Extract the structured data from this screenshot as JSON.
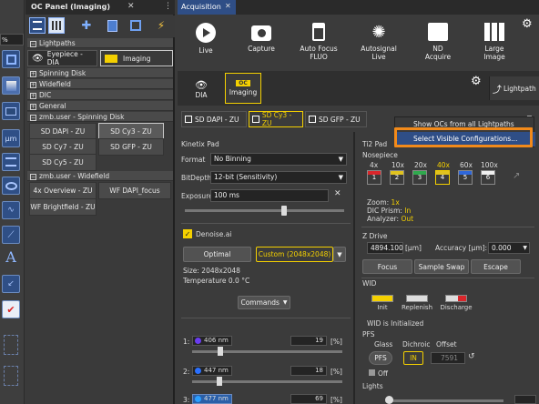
{
  "left_toolbar": {
    "zoom_value": "%"
  },
  "oc_panel": {
    "tab_title": "OC Panel (Imaging)",
    "lightpaths": {
      "header": "Lightpaths",
      "eyepiece": "Eyepiece - DIA",
      "imaging": "Imaging"
    },
    "groups": [
      "Spinning Disk",
      "Widefield",
      "DIC",
      "General"
    ],
    "spinning": {
      "header": "zmb.user - Spinning Disk",
      "items": [
        "SD DAPI - ZU",
        "SD Cy3 - ZU",
        "SD Cy7 - ZU",
        "SD GFP - ZU",
        "SD Cy5 - ZU"
      ]
    },
    "widefield": {
      "header": "zmb.user - Widefield",
      "items": [
        "4x Overview - ZU",
        "WF DAPI_focus",
        "WF Brightfield - ZU"
      ]
    }
  },
  "acquisition": {
    "tab_title": "Acquisition",
    "buttons": [
      {
        "label": "Live",
        "icon": "play-icon"
      },
      {
        "label": "Capture",
        "icon": "camera-icon"
      },
      {
        "label": "Auto Focus\nFLUO",
        "icon": "autofocus-icon"
      },
      {
        "label": "Autosignal\nLive",
        "icon": "brightness-icon"
      },
      {
        "label": "ND\nAcquire",
        "icon": "nd-icon"
      },
      {
        "label": "Large\nImage",
        "icon": "large-image-icon"
      }
    ],
    "mode_tabs": [
      {
        "label": "DIA"
      },
      {
        "label": "Imaging",
        "badge": "OC"
      }
    ],
    "lightpath_label": "Lightpath",
    "config_tabs": [
      "SD DAPI - ZU",
      "SD Cy3 - ZU",
      "SD GFP - ZU"
    ],
    "dropdown_menu": [
      "Show OCs from all Lightpaths",
      "Select Visible Configurations..."
    ]
  },
  "camera": {
    "title": "Kinetix Pad",
    "format_label": "Format",
    "format_value": "No Binning",
    "bitdepth_label": "BitDepth",
    "bitdepth_value": "12-bit (Sensitivity)",
    "exposure_label": "Exposure",
    "exposure_value": "100 ms",
    "exposure_slider": 0.62,
    "denoise_label": "Denoise.ai",
    "denoise_checked": true,
    "optimal_label": "Optimal",
    "custom_label": "Custom (2048x2048)",
    "size_text": "Size: 2048x2048",
    "temp_text": "Temperature 0.0 °C",
    "commands_label": "Commands"
  },
  "lasers": [
    {
      "index": "1:",
      "label": "406 nm",
      "color": "#6a3cf0",
      "value": "19",
      "unit": "[%]",
      "level": 0.19
    },
    {
      "index": "2:",
      "label": "447 nm",
      "color": "#2a70ff",
      "value": "18",
      "unit": "[%]",
      "level": 0.18
    },
    {
      "index": "3:",
      "label": "477 nm",
      "color": "#2a9fff",
      "value": "69",
      "unit": "[%]",
      "level": 0.69
    }
  ],
  "ti2": {
    "title": "Ti2 Pad",
    "nosepiece_label": "Nosepiece",
    "objectives": [
      {
        "mag": "4x",
        "num": "1",
        "color": "#d9262b"
      },
      {
        "mag": "10x",
        "num": "2",
        "color": "#e0c21f"
      },
      {
        "mag": "20x",
        "num": "3",
        "color": "#2fa94d"
      },
      {
        "mag": "40x",
        "num": "4",
        "color": "#e0c21f",
        "selected": true
      },
      {
        "mag": "60x",
        "num": "5",
        "color": "#2f67d9"
      },
      {
        "mag": "100x",
        "num": "6",
        "color": "#f0f0f0"
      }
    ],
    "zoom_label": "Zoom:",
    "zoom_value": "1x",
    "dic_label": "DIC Prism:",
    "dic_value": "In",
    "analyzer_label": "Analyzer:",
    "analyzer_value": "Out",
    "zdrive_label": "Z Drive",
    "z_value": "4894.100",
    "z_unit": "[µm]",
    "accuracy_label": "Accuracy [µm]:",
    "accuracy_value": "0.000",
    "focus_btn": "Focus",
    "sample_swap_btn": "Sample Swap",
    "escape_btn": "Escape",
    "wid_label": "WID",
    "wid_buttons": [
      "Init",
      "Replenish",
      "Discharge"
    ],
    "wid_status": "WID is Initialized",
    "pfs_label": "PFS",
    "pfs_cols": [
      "Glass",
      "Dichroic",
      "Offset"
    ],
    "pfs_btn": "PFS",
    "dichroic_value": "IN",
    "offset_value": "7591",
    "off_label": "Off",
    "lights_label": "Lights"
  }
}
